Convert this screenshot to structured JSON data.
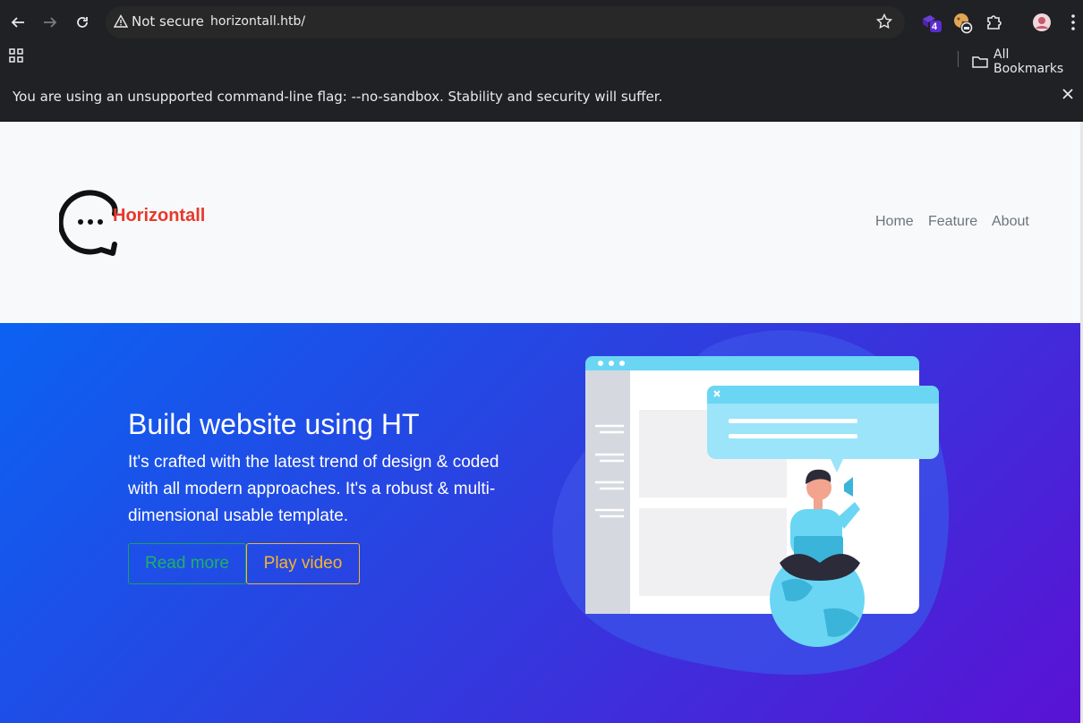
{
  "browser": {
    "security_label": "Not secure",
    "url": "horizontall.htb/",
    "extension_badge": "4",
    "all_bookmarks": "All Bookmarks",
    "infobar_message": "You are using an unsupported command-line flag: --no-sandbox. Stability and security will suffer."
  },
  "site": {
    "logo_text": "Horizontall",
    "nav": [
      "Home",
      "Feature",
      "About"
    ]
  },
  "hero": {
    "title": "Build website using HT",
    "description": "It's crafted with the latest trend of design & coded with all modern approaches. It's a robust & multi-dimensional usable template.",
    "read_more": "Read more",
    "play_video": "Play video"
  },
  "colors": {
    "brand_red": "#e8382a",
    "hero_gradient_start": "#0b62f2",
    "hero_gradient_end": "#5a12d4",
    "read_more_green": "#1db360",
    "play_video_orange": "#f7b32b"
  }
}
